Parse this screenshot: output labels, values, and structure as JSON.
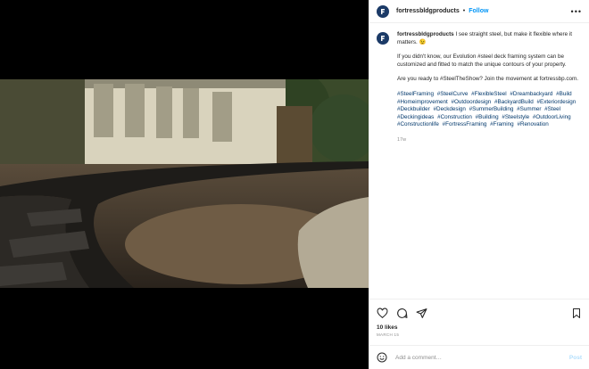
{
  "header": {
    "username": "fortressbldgproducts",
    "separator": "•",
    "follow_label": "Follow",
    "more_label": "•••"
  },
  "caption": {
    "username": "fortressbldgproducts",
    "first_line": "I see straight steel, but make it flexible where it matters. 😉",
    "paragraph2": "If you didn't know, our Evolution #steel deck framing system can be customized and fitted to match the unique contours of your property.",
    "paragraph3": "Are you ready to #SteelTheShow? Join the movement at fortressbp.com.",
    "hashtags": [
      "#SteelFraming",
      "#SteelCurve",
      "#FlexibleSteel",
      "#Dreambackyard",
      "#Build",
      "#Homeimprovement",
      "#Outdoordesign",
      "#BackyardBuild",
      "#Exteriordesign",
      "#Deckbuilder",
      "#Deckdesign",
      "#SummerBuilding",
      "#Summer",
      "#Steel",
      "#Deckingideas",
      "#Construction",
      "#Building",
      "#Steelstyle",
      "#OutdoorLiving",
      "#Constructionlife",
      "#FortressFraming",
      "#Framing",
      "#Renovation"
    ],
    "age": "17w"
  },
  "actions": {
    "likes": "10 likes",
    "date": "MARCH 15"
  },
  "comment": {
    "placeholder": "Add a comment…",
    "post_label": "Post"
  },
  "colors": {
    "accent": "#0095f6",
    "hashtag": "#00376b",
    "muted": "#8e8e8e",
    "avatar": "#1b3a67"
  },
  "icons": [
    "heart-icon",
    "comment-icon",
    "share-icon",
    "bookmark-icon",
    "emoji-icon"
  ]
}
